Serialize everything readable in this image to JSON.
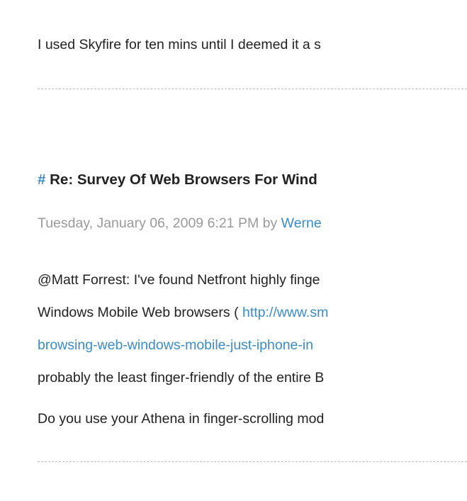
{
  "comment_prev": {
    "text_line1": "I used Skyfire for ten mins until I deemed it a s"
  },
  "comment": {
    "hash": "#",
    "title": "Re: Survey Of Web Browsers For Wind",
    "date": "Tuesday, January 06, 2009 6:21 PM",
    "by_word": "by",
    "author": "Werne",
    "body": {
      "line1": "@Matt Forrest: I've found Netfront highly finge",
      "line2_prefix": "Windows Mobile Web browsers ( ",
      "line2_link": "http://www.sm",
      "line3_link": "browsing-web-windows-mobile-just-iphone-in",
      "line4": "probably the least finger-friendly of the entire B",
      "line5": "Do you use your Athena in finger-scrolling mod"
    }
  },
  "colors": {
    "link": "#3a8cc9",
    "meta": "#9a9a9a",
    "text": "#222222",
    "divider": "#bdbdbd"
  }
}
